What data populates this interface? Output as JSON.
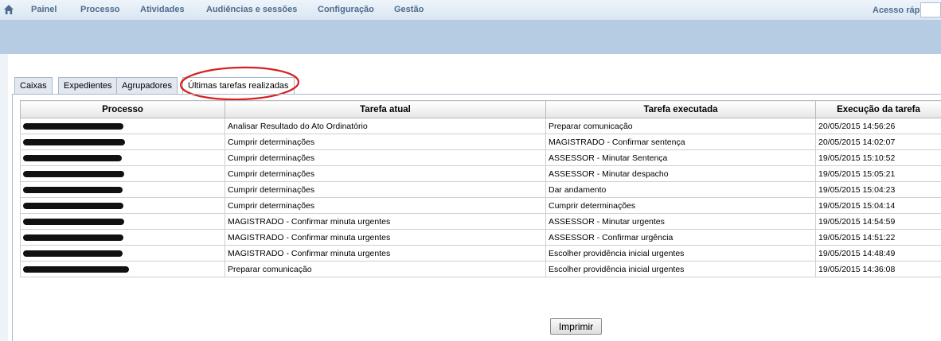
{
  "topbar": {
    "home_icon": "home-icon",
    "menu": [
      "Painel",
      "Processo",
      "Atividades",
      "Audiências e sessões",
      "Configuração",
      "Gestão"
    ],
    "quick_access_label": "Acesso rápido:",
    "quick_access_value": ""
  },
  "tabs": [
    {
      "label": "Caixas",
      "active": false
    },
    {
      "label": "Expedientes",
      "active": false
    },
    {
      "label": "Agrupadores",
      "active": false
    },
    {
      "label": "Últimas tarefas realizadas",
      "active": true
    }
  ],
  "annotation_color": "#d62020",
  "table": {
    "columns": [
      "Processo",
      "Tarefa atual",
      "Tarefa executada",
      "Execução da tarefa"
    ],
    "rows": [
      {
        "processo": "",
        "tarefa_atual": "Analisar Resultado do Ato Ordinatório",
        "tarefa_executada": "Preparar comunicação",
        "execucao": "20/05/2015 14:56:26"
      },
      {
        "processo": "",
        "tarefa_atual": "Cumprir determinações",
        "tarefa_executada": "MAGISTRADO - Confirmar sentença",
        "execucao": "20/05/2015 14:02:07"
      },
      {
        "processo": "",
        "tarefa_atual": "Cumprir determinações",
        "tarefa_executada": "ASSESSOR - Minutar Sentença",
        "execucao": "19/05/2015 15:10:52"
      },
      {
        "processo": "",
        "tarefa_atual": "Cumprir determinações",
        "tarefa_executada": "ASSESSOR - Minutar despacho",
        "execucao": "19/05/2015 15:05:21"
      },
      {
        "processo": "",
        "tarefa_atual": "Cumprir determinações",
        "tarefa_executada": "Dar andamento",
        "execucao": "19/05/2015 15:04:23"
      },
      {
        "processo": "",
        "tarefa_atual": "Cumprir determinações",
        "tarefa_executada": "Cumprir determinações",
        "execucao": "19/05/2015 15:04:14"
      },
      {
        "processo": "",
        "tarefa_atual": "MAGISTRADO - Confirmar minuta urgentes",
        "tarefa_executada": "ASSESSOR - Minutar urgentes",
        "execucao": "19/05/2015 14:54:59"
      },
      {
        "processo": "",
        "tarefa_atual": "MAGISTRADO - Confirmar minuta urgentes",
        "tarefa_executada": "ASSESSOR - Confirmar urgência",
        "execucao": "19/05/2015 14:51:22"
      },
      {
        "processo": "",
        "tarefa_atual": "MAGISTRADO - Confirmar minuta urgentes",
        "tarefa_executada": "Escolher providência inicial urgentes",
        "execucao": "19/05/2015 14:48:49"
      },
      {
        "processo": "",
        "tarefa_atual": "Preparar comunicação",
        "tarefa_executada": "Escolher providência inicial urgentes",
        "execucao": "19/05/2015 14:36:08"
      }
    ]
  },
  "print_button": "Imprimir"
}
